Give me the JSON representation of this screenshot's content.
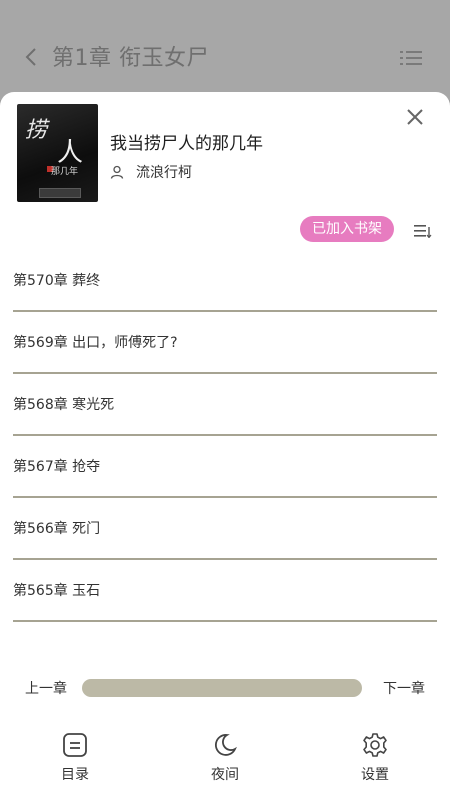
{
  "top_bar": {
    "chapter_title": "第1章 衔玉女尸"
  },
  "book": {
    "title": "我当捞尸人的那几年",
    "author": "流浪行柯",
    "cover": {
      "line1": "捞",
      "line2": "人",
      "line3": "那几年"
    }
  },
  "shelf_badge": "已加入书架",
  "chapters": [
    "第570章 葬终",
    "第569章 出口，师傅死了?",
    "第568章 寒光死",
    "第567章 抢夺",
    "第566章 死门",
    "第565章 玉石"
  ],
  "progress": {
    "prev_label": "上一章",
    "next_label": "下一章",
    "value": 0
  },
  "bottom_nav": {
    "catalog": "目录",
    "night": "夜间",
    "settings": "设置"
  },
  "colors": {
    "badge": "#e77cc0",
    "divider": "#a6a392",
    "track": "#bcb9a6"
  }
}
